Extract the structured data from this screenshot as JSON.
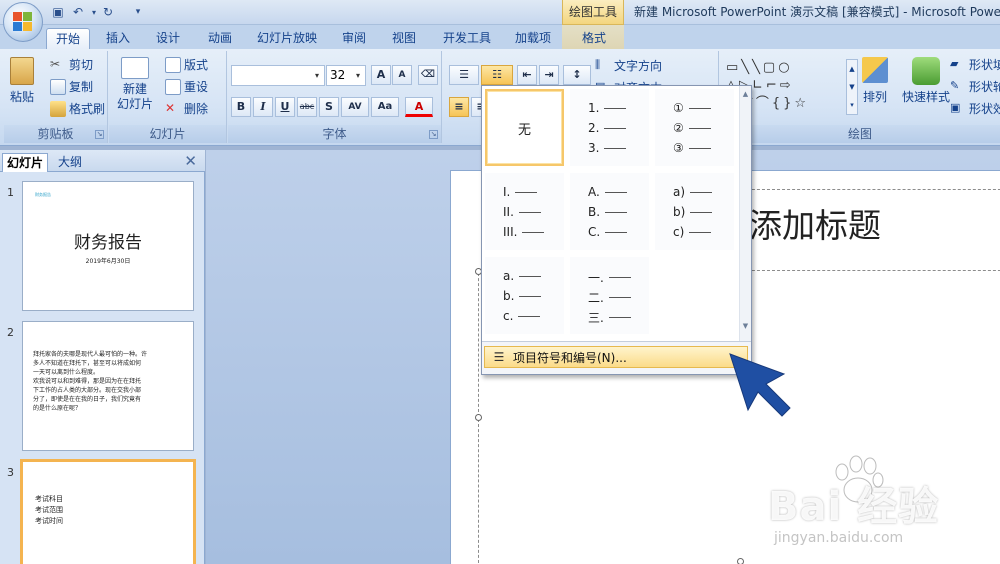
{
  "titlebar": {
    "context_tab_group": "绘图工具",
    "window_title": "新建 Microsoft PowerPoint 演示文稿 [兼容模式] - Microsoft PowerPo",
    "qat": [
      "save-icon",
      "undo-icon",
      "redo-icon",
      "customize-icon"
    ]
  },
  "tabs": [
    {
      "label": "开始",
      "active": true
    },
    {
      "label": "插入"
    },
    {
      "label": "设计"
    },
    {
      "label": "动画"
    },
    {
      "label": "幻灯片放映"
    },
    {
      "label": "审阅"
    },
    {
      "label": "视图"
    },
    {
      "label": "开发工具"
    },
    {
      "label": "加载项"
    },
    {
      "label": "格式",
      "contextual": true
    }
  ],
  "ribbon": {
    "clipboard": {
      "label": "剪贴板",
      "paste": "粘贴",
      "cut": "剪切",
      "copy": "复制",
      "format_painter": "格式刷"
    },
    "slides": {
      "label": "幻灯片",
      "new_slide": "新建\n幻灯片",
      "layout": "版式",
      "reset": "重设",
      "delete": "删除"
    },
    "font": {
      "label": "字体",
      "font_name": "",
      "font_size": "32",
      "bold": "B",
      "italic": "I",
      "underline": "U",
      "strike": "abc",
      "shadow": "S",
      "spacing": "AV",
      "case": "Aa",
      "color": "A",
      "grow": "A",
      "shrink": "A"
    },
    "paragraph": {
      "text_direction": "文字方向",
      "align_text": "对齐文本"
    },
    "drawing": {
      "label": "绘图",
      "arrange": "排列",
      "quick_styles": "快速样式",
      "shape_fill": "形状填",
      "shape_outline": "形状轮",
      "shape_effects": "形状效"
    }
  },
  "left_panel": {
    "tab_slides": "幻灯片",
    "tab_outline": "大纲",
    "thumbnails": [
      {
        "number": "1",
        "title": "财务报告",
        "subtitle": "2019年6月30日",
        "corner": "财务报告"
      },
      {
        "number": "2",
        "lines": [
          "拜托家各的夫哪是现代人最可怕的一种。许",
          "多人不知道在拜托下，甚至可以将成如何",
          "一天可以离到什么程度。",
          "欢我说可以和到难得，那是因为在在拜托",
          "下工作的占人类的大部分。现在交我小部",
          "分了，即使是在在我的日子，我们究竟有",
          "的是什么原在呢？"
        ]
      },
      {
        "number": "3",
        "lines": [
          "考试科目",
          "考试范围",
          "考试时间"
        ],
        "selected": true
      }
    ]
  },
  "slide": {
    "title_placeholder": "添加标题"
  },
  "numbering_gallery": {
    "cells": [
      {
        "type": "none",
        "label": "无",
        "selected": true
      },
      {
        "type": "list",
        "items": [
          "1.",
          "2.",
          "3."
        ]
      },
      {
        "type": "list",
        "items": [
          "①",
          "②",
          "③"
        ]
      },
      {
        "type": "list",
        "items": [
          "I.",
          "II.",
          "III."
        ]
      },
      {
        "type": "list",
        "items": [
          "A.",
          "B.",
          "C."
        ]
      },
      {
        "type": "list",
        "items": [
          "a)",
          "b)",
          "c)"
        ]
      },
      {
        "type": "list",
        "items": [
          "a.",
          "b.",
          "c."
        ]
      },
      {
        "type": "list",
        "items": [
          "一.",
          "二.",
          "三."
        ]
      }
    ],
    "footer_item": "项目符号和编号(N)..."
  },
  "colors": {
    "accent": "#f6c76a",
    "ribbon": "#d6e4f5",
    "cursor": "#1f4fa3"
  },
  "watermark": {
    "text": "Bai 经验",
    "url": "jingyan.baidu.com"
  }
}
